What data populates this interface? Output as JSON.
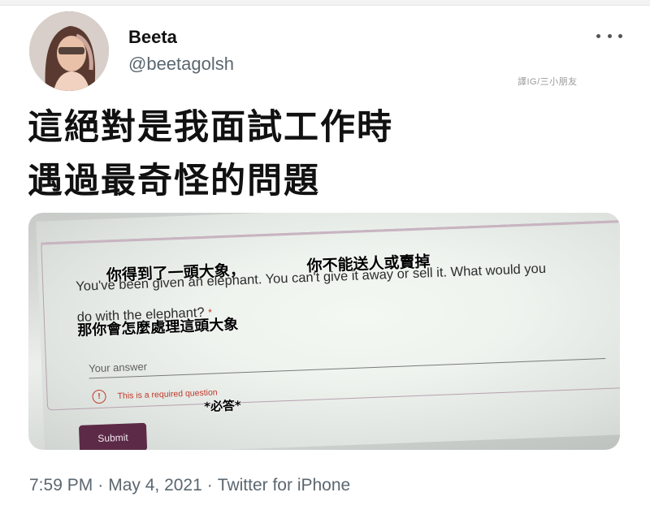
{
  "tweet": {
    "display_name": "Beeta",
    "handle": "@beetagolsh",
    "watermark": "譯IG/三小朋友",
    "text_line1": "這絕對是我面試工作時",
    "text_line2": "遇過最奇怪的問題",
    "more_icon": "more-dots-icon"
  },
  "form": {
    "zh_part1": "你得到了一頭大象，",
    "zh_part2": "你不能送人或賣掉",
    "question_line1": "You've been given an elephant. You can't give it away or sell it. What would you",
    "question_line2": "do with the elephant?",
    "required_star": "*",
    "zh_part3": "那你會怎麼處理這頭大象",
    "answer_placeholder": "Your answer",
    "error_text": "This is a required question",
    "error_icon": "!",
    "zh_required": "*必答*",
    "submit_label": "Submit",
    "accent_color": "#5c2a47"
  },
  "footer": {
    "time": "7:59 PM",
    "date": "May 4, 2021",
    "source": "Twitter for iPhone",
    "separator": "·"
  }
}
